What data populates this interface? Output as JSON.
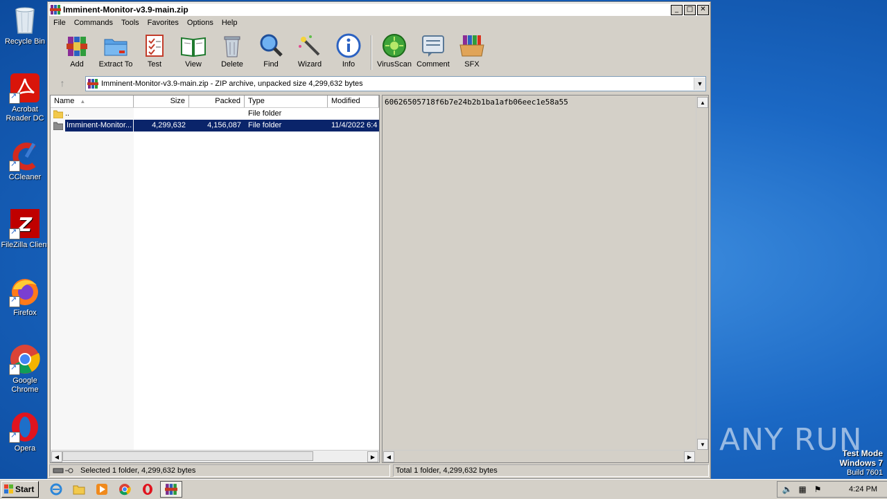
{
  "desktop": {
    "icons": [
      {
        "label": "Recycle Bin",
        "icon": "recycle-bin-icon"
      },
      {
        "label": "Acrobat Reader DC",
        "icon": "acrobat-icon"
      },
      {
        "label": "CCleaner",
        "icon": "ccleaner-icon"
      },
      {
        "label": "FileZilla Client",
        "icon": "filezilla-icon"
      },
      {
        "label": "Firefox",
        "icon": "firefox-icon"
      },
      {
        "label": "Google Chrome",
        "icon": "chrome-icon"
      },
      {
        "label": "Opera",
        "icon": "opera-icon"
      }
    ],
    "watermark": "ANY RUN",
    "test_mode": {
      "line1": "Test Mode",
      "line2": "Windows 7",
      "line3": "Build 7601"
    }
  },
  "window": {
    "title": "Imminent-Monitor-v3.9-main.zip",
    "menu": [
      "File",
      "Commands",
      "Tools",
      "Favorites",
      "Options",
      "Help"
    ],
    "toolbar": [
      {
        "label": "Add",
        "icon": "add-archive-icon"
      },
      {
        "label": "Extract To",
        "icon": "extract-folder-icon"
      },
      {
        "label": "Test",
        "icon": "test-checklist-icon"
      },
      {
        "label": "View",
        "icon": "view-book-icon"
      },
      {
        "label": "Delete",
        "icon": "trash-can-icon"
      },
      {
        "label": "Find",
        "icon": "magnifier-icon"
      },
      {
        "label": "Wizard",
        "icon": "magic-wand-icon"
      },
      {
        "label": "Info",
        "icon": "info-icon"
      },
      {
        "label": "VirusScan",
        "icon": "virus-scan-icon"
      },
      {
        "label": "Comment",
        "icon": "comment-icon"
      },
      {
        "label": "SFX",
        "icon": "sfx-box-icon"
      }
    ],
    "address": "Imminent-Monitor-v3.9-main.zip - ZIP archive, unpacked size 4,299,632 bytes",
    "columns": {
      "name": "Name",
      "size": "Size",
      "packed": "Packed",
      "type": "Type",
      "modified": "Modified"
    },
    "rows": [
      {
        "name": "..",
        "size": "",
        "packed": "",
        "type": "File folder",
        "modified": ""
      },
      {
        "name": "Imminent-Monitor...",
        "size": "4,299,632",
        "packed": "4,156,087",
        "type": "File folder",
        "modified": "11/4/2022 6:4"
      }
    ],
    "comment": "60626505718f6b7e24b2b1ba1afb06eec1e58a55",
    "status_left": "Selected 1 folder, 4,299,632 bytes",
    "status_right": "Total 1 folder, 4,299,632 bytes"
  },
  "taskbar": {
    "start_label": "Start",
    "clock": "4:24 PM"
  }
}
